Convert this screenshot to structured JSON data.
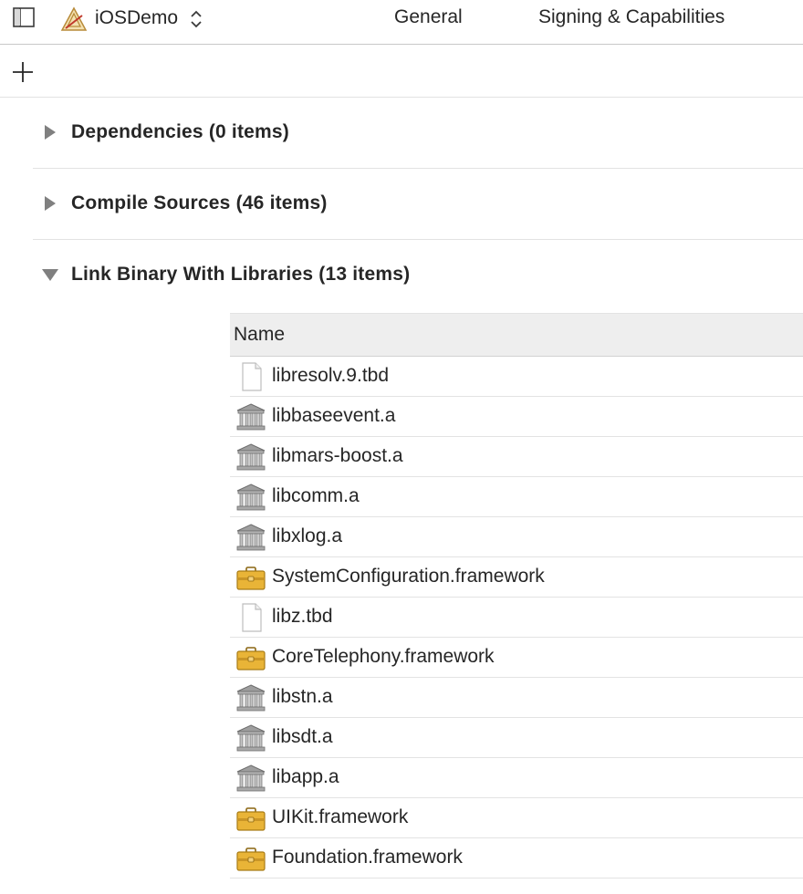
{
  "toolbar": {
    "sidebar_icon": "sidebar-toggle-icon",
    "project_icon": "xcode-app-icon",
    "scheme_name": "iOSDemo",
    "tabs": [
      {
        "label": "General"
      },
      {
        "label": "Signing & Capabilities"
      }
    ]
  },
  "add_button_icon": "plus-icon",
  "phases": [
    {
      "title": "Dependencies (0 items)",
      "expanded": false
    },
    {
      "title": "Compile Sources (46 items)",
      "expanded": false
    },
    {
      "title": "Link Binary With Libraries (13 items)",
      "expanded": true
    }
  ],
  "libraries": {
    "column_header": "Name",
    "items": [
      {
        "name": "libresolv.9.tbd",
        "icon": "document-icon"
      },
      {
        "name": "libbaseevent.a",
        "icon": "library-icon"
      },
      {
        "name": "libmars-boost.a",
        "icon": "library-icon"
      },
      {
        "name": "libcomm.a",
        "icon": "library-icon"
      },
      {
        "name": "libxlog.a",
        "icon": "library-icon"
      },
      {
        "name": "SystemConfiguration.framework",
        "icon": "framework-toolbox-icon"
      },
      {
        "name": "libz.tbd",
        "icon": "document-icon"
      },
      {
        "name": "CoreTelephony.framework",
        "icon": "framework-toolbox-icon"
      },
      {
        "name": "libstn.a",
        "icon": "library-icon"
      },
      {
        "name": "libsdt.a",
        "icon": "library-icon"
      },
      {
        "name": "libapp.a",
        "icon": "library-icon"
      },
      {
        "name": "UIKit.framework",
        "icon": "framework-toolbox-icon"
      },
      {
        "name": "Foundation.framework",
        "icon": "framework-toolbox-icon"
      }
    ]
  },
  "colors": {
    "text": "#262626",
    "disclosure": "#808080",
    "framework_yellow": "#e9b437",
    "library_gray": "#8a8a8a"
  }
}
